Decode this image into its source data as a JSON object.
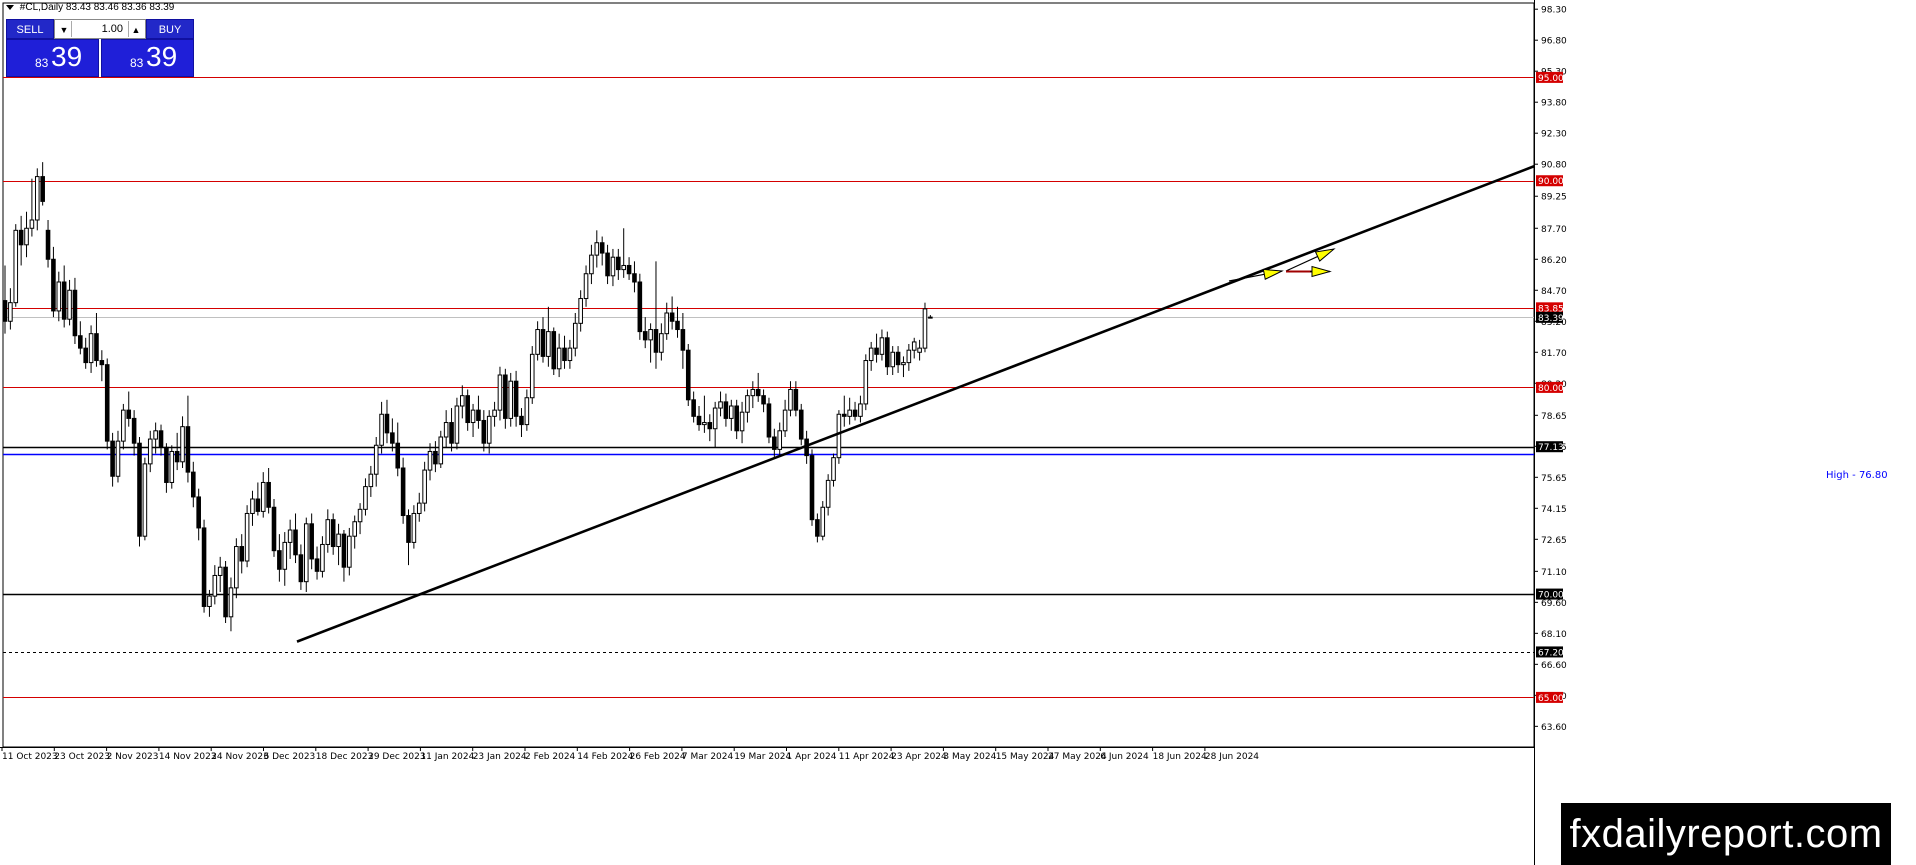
{
  "header": {
    "symbol": "#CL,Daily",
    "ohlc": "83.43 83.46 83.36 83.39"
  },
  "trade_panel": {
    "sell_label": "SELL",
    "buy_label": "BUY",
    "lot_value": "1.00",
    "sell_small": "83",
    "sell_big": "39",
    "buy_small": "83",
    "buy_big": "39"
  },
  "watermark": "fxdailyreport.com",
  "colors": {
    "support_resistance_red": "#d40000",
    "blue_line": "#0000ff",
    "trendline": "#000000",
    "arrow_yellow": "#ffff00",
    "candle_up": "#ffffff",
    "candle_down": "#000000",
    "panel_blue": "#1f1fd8"
  },
  "chart_data": {
    "type": "candlestick",
    "y_range": [
      62.6,
      98.6
    ],
    "y_ticks": [
      "98.30",
      "96.80",
      "95.30",
      "93.80",
      "92.30",
      "90.80",
      "89.25",
      "87.70",
      "86.20",
      "84.70",
      "83.20",
      "81.70",
      "80.20",
      "78.65",
      "77.15",
      "75.65",
      "74.15",
      "72.65",
      "71.10",
      "69.60",
      "68.10",
      "66.60",
      "65.10",
      "63.60"
    ],
    "x_ticks": [
      "11 Oct 2023",
      "23 Oct 2023",
      "2 Nov 2023",
      "14 Nov 2023",
      "24 Nov 2023",
      "6 Dec 2023",
      "18 Dec 2023",
      "29 Dec 2023",
      "11 Jan 2024",
      "23 Jan 2024",
      "2 Feb 2024",
      "14 Feb 2024",
      "26 Feb 2024",
      "7 Mar 2024",
      "19 Mar 2024",
      "1 Apr 2024",
      "11 Apr 2024",
      "23 Apr 2024",
      "3 May 2024",
      "15 May 2024",
      "27 May 2024",
      "6 Jun 2024",
      "18 Jun 2024",
      "28 Jun 2024"
    ],
    "horizontal_lines": [
      {
        "price": 95.0,
        "label": "95.00",
        "style": "red"
      },
      {
        "price": 90.0,
        "label": "90.00",
        "style": "red"
      },
      {
        "price": 83.85,
        "label": "83.85",
        "style": "red"
      },
      {
        "price": 80.0,
        "label": "80.00",
        "style": "red"
      },
      {
        "price": 77.13,
        "label": "77.13",
        "style": "black"
      },
      {
        "price": 76.8,
        "label": "",
        "style": "blue"
      },
      {
        "price": 70.0,
        "label": "70.00",
        "style": "black-thick"
      },
      {
        "price": 67.2,
        "label": "67.20",
        "style": "dashed"
      },
      {
        "price": 65.0,
        "label": "65.00",
        "style": "red"
      }
    ],
    "current_price": {
      "price": 83.39,
      "label": "83.39"
    },
    "high_label": "High - 76.80",
    "trendline": {
      "from": {
        "date": "18 Dec 2023",
        "price": 67.7
      },
      "to": {
        "date": "right edge",
        "price": 90.7
      }
    },
    "arrows": [
      {
        "from": [
          83.4,
          "28 Jun 2024"
        ],
        "to": [
          83.85
        ],
        "color": "yellow"
      },
      {
        "direction": "up",
        "color": "yellow"
      },
      {
        "direction": "right",
        "color": "yellow"
      }
    ],
    "candles": [
      {
        "o": 84.2,
        "h": 85.9,
        "l": 82.6,
        "c": 83.2
      },
      {
        "o": 83.2,
        "h": 84.8,
        "l": 82.8,
        "c": 84.1
      },
      {
        "o": 84.1,
        "h": 87.9,
        "l": 83.9,
        "c": 87.6
      },
      {
        "o": 87.6,
        "h": 88.3,
        "l": 85.9,
        "c": 86.9
      },
      {
        "o": 86.9,
        "h": 88.5,
        "l": 86.3,
        "c": 87.7
      },
      {
        "o": 87.7,
        "h": 90.1,
        "l": 87.3,
        "c": 88.1
      },
      {
        "o": 88.1,
        "h": 90.6,
        "l": 87.6,
        "c": 90.2
      },
      {
        "o": 90.2,
        "h": 90.9,
        "l": 88.8,
        "c": 89.0
      },
      {
        "o": 87.6,
        "h": 88.1,
        "l": 85.8,
        "c": 86.2
      },
      {
        "o": 86.2,
        "h": 86.8,
        "l": 83.4,
        "c": 83.7
      },
      {
        "o": 83.7,
        "h": 85.6,
        "l": 83.2,
        "c": 85.1
      },
      {
        "o": 85.1,
        "h": 85.9,
        "l": 82.9,
        "c": 83.3
      },
      {
        "o": 83.3,
        "h": 85.2,
        "l": 83.0,
        "c": 84.7
      },
      {
        "o": 84.7,
        "h": 85.3,
        "l": 82.1,
        "c": 82.5
      },
      {
        "o": 82.5,
        "h": 83.2,
        "l": 81.6,
        "c": 81.9
      },
      {
        "o": 81.9,
        "h": 82.4,
        "l": 80.9,
        "c": 81.2
      },
      {
        "o": 81.2,
        "h": 83.0,
        "l": 80.7,
        "c": 82.6
      },
      {
        "o": 82.6,
        "h": 83.6,
        "l": 81.0,
        "c": 81.3
      },
      {
        "o": 81.3,
        "h": 81.8,
        "l": 80.3,
        "c": 81.1
      },
      {
        "o": 81.1,
        "h": 81.4,
        "l": 77.0,
        "c": 77.4
      },
      {
        "o": 77.4,
        "h": 77.8,
        "l": 75.2,
        "c": 75.7
      },
      {
        "o": 75.7,
        "h": 77.9,
        "l": 75.4,
        "c": 77.4
      },
      {
        "o": 77.4,
        "h": 79.2,
        "l": 77.0,
        "c": 78.9
      },
      {
        "o": 78.9,
        "h": 79.8,
        "l": 78.1,
        "c": 78.5
      },
      {
        "o": 78.5,
        "h": 78.9,
        "l": 76.7,
        "c": 77.3
      },
      {
        "o": 77.3,
        "h": 77.6,
        "l": 72.3,
        "c": 72.8
      },
      {
        "o": 72.8,
        "h": 76.6,
        "l": 72.6,
        "c": 76.3
      },
      {
        "o": 76.3,
        "h": 77.9,
        "l": 75.9,
        "c": 77.5
      },
      {
        "o": 77.5,
        "h": 78.3,
        "l": 76.8,
        "c": 77.9
      },
      {
        "o": 77.9,
        "h": 78.2,
        "l": 76.7,
        "c": 77.1
      },
      {
        "o": 77.1,
        "h": 77.3,
        "l": 74.9,
        "c": 75.4
      },
      {
        "o": 75.4,
        "h": 77.2,
        "l": 75.1,
        "c": 76.9
      },
      {
        "o": 76.9,
        "h": 77.8,
        "l": 76.0,
        "c": 76.4
      },
      {
        "o": 76.4,
        "h": 78.6,
        "l": 76.1,
        "c": 78.1
      },
      {
        "o": 78.1,
        "h": 79.6,
        "l": 75.4,
        "c": 75.9
      },
      {
        "o": 75.9,
        "h": 76.4,
        "l": 74.2,
        "c": 74.7
      },
      {
        "o": 74.7,
        "h": 75.1,
        "l": 72.6,
        "c": 73.2
      },
      {
        "o": 73.2,
        "h": 73.6,
        "l": 69.1,
        "c": 69.4
      },
      {
        "o": 69.4,
        "h": 70.2,
        "l": 68.9,
        "c": 69.9
      },
      {
        "o": 69.9,
        "h": 71.4,
        "l": 69.5,
        "c": 70.9
      },
      {
        "o": 70.9,
        "h": 71.8,
        "l": 70.1,
        "c": 71.3
      },
      {
        "o": 71.3,
        "h": 71.6,
        "l": 68.6,
        "c": 68.9
      },
      {
        "o": 68.9,
        "h": 70.8,
        "l": 68.2,
        "c": 70.3
      },
      {
        "o": 70.3,
        "h": 72.7,
        "l": 69.8,
        "c": 72.3
      },
      {
        "o": 72.3,
        "h": 72.9,
        "l": 71.0,
        "c": 71.6
      },
      {
        "o": 71.6,
        "h": 74.3,
        "l": 71.3,
        "c": 73.9
      },
      {
        "o": 73.9,
        "h": 75.0,
        "l": 73.3,
        "c": 74.6
      },
      {
        "o": 74.6,
        "h": 75.4,
        "l": 73.8,
        "c": 74.0
      },
      {
        "o": 74.0,
        "h": 75.9,
        "l": 73.7,
        "c": 75.4
      },
      {
        "o": 75.4,
        "h": 76.1,
        "l": 73.9,
        "c": 74.2
      },
      {
        "o": 74.2,
        "h": 74.6,
        "l": 71.8,
        "c": 72.1
      },
      {
        "o": 72.1,
        "h": 72.9,
        "l": 70.6,
        "c": 71.2
      },
      {
        "o": 71.2,
        "h": 73.0,
        "l": 70.4,
        "c": 72.5
      },
      {
        "o": 72.5,
        "h": 73.6,
        "l": 71.7,
        "c": 73.1
      },
      {
        "o": 73.1,
        "h": 73.9,
        "l": 71.5,
        "c": 71.9
      },
      {
        "o": 71.9,
        "h": 72.4,
        "l": 70.2,
        "c": 70.6
      },
      {
        "o": 70.6,
        "h": 73.7,
        "l": 70.1,
        "c": 73.4
      },
      {
        "o": 73.4,
        "h": 73.9,
        "l": 71.2,
        "c": 71.7
      },
      {
        "o": 71.7,
        "h": 72.3,
        "l": 70.7,
        "c": 71.1
      },
      {
        "o": 71.1,
        "h": 72.8,
        "l": 70.8,
        "c": 72.4
      },
      {
        "o": 72.4,
        "h": 74.1,
        "l": 72.0,
        "c": 73.6
      },
      {
        "o": 73.6,
        "h": 73.9,
        "l": 71.9,
        "c": 72.3
      },
      {
        "o": 72.3,
        "h": 73.4,
        "l": 71.4,
        "c": 72.9
      },
      {
        "o": 72.9,
        "h": 73.1,
        "l": 70.6,
        "c": 71.3
      },
      {
        "o": 71.3,
        "h": 73.2,
        "l": 70.9,
        "c": 72.8
      },
      {
        "o": 72.8,
        "h": 73.8,
        "l": 72.2,
        "c": 73.5
      },
      {
        "o": 73.5,
        "h": 74.4,
        "l": 72.9,
        "c": 74.1
      },
      {
        "o": 74.1,
        "h": 75.6,
        "l": 73.8,
        "c": 75.2
      },
      {
        "o": 75.2,
        "h": 76.2,
        "l": 74.7,
        "c": 75.8
      },
      {
        "o": 75.8,
        "h": 77.6,
        "l": 75.2,
        "c": 77.2
      },
      {
        "o": 77.2,
        "h": 79.3,
        "l": 76.8,
        "c": 78.7
      },
      {
        "o": 78.7,
        "h": 79.4,
        "l": 77.3,
        "c": 77.8
      },
      {
        "o": 77.8,
        "h": 78.5,
        "l": 76.9,
        "c": 77.3
      },
      {
        "o": 77.3,
        "h": 78.3,
        "l": 75.7,
        "c": 76.1
      },
      {
        "o": 76.1,
        "h": 76.6,
        "l": 73.4,
        "c": 73.8
      },
      {
        "o": 73.8,
        "h": 74.1,
        "l": 71.4,
        "c": 72.5
      },
      {
        "o": 72.5,
        "h": 74.3,
        "l": 72.2,
        "c": 73.9
      },
      {
        "o": 73.9,
        "h": 74.9,
        "l": 73.5,
        "c": 74.4
      },
      {
        "o": 74.4,
        "h": 76.4,
        "l": 74.0,
        "c": 76.0
      },
      {
        "o": 76.0,
        "h": 77.3,
        "l": 75.5,
        "c": 76.9
      },
      {
        "o": 76.9,
        "h": 77.4,
        "l": 75.9,
        "c": 76.3
      },
      {
        "o": 76.3,
        "h": 77.9,
        "l": 76.1,
        "c": 77.6
      },
      {
        "o": 77.6,
        "h": 78.9,
        "l": 77.1,
        "c": 78.3
      },
      {
        "o": 78.3,
        "h": 79.0,
        "l": 76.9,
        "c": 77.3
      },
      {
        "o": 77.3,
        "h": 79.5,
        "l": 77.0,
        "c": 79.1
      },
      {
        "o": 79.1,
        "h": 80.1,
        "l": 78.5,
        "c": 79.6
      },
      {
        "o": 79.6,
        "h": 79.9,
        "l": 77.9,
        "c": 78.3
      },
      {
        "o": 78.3,
        "h": 79.2,
        "l": 77.6,
        "c": 78.9
      },
      {
        "o": 78.9,
        "h": 79.6,
        "l": 78.0,
        "c": 78.4
      },
      {
        "o": 78.4,
        "h": 78.9,
        "l": 76.9,
        "c": 77.3
      },
      {
        "o": 77.3,
        "h": 78.9,
        "l": 76.8,
        "c": 78.6
      },
      {
        "o": 78.6,
        "h": 79.3,
        "l": 78.1,
        "c": 78.9
      },
      {
        "o": 78.9,
        "h": 81.0,
        "l": 78.4,
        "c": 80.6
      },
      {
        "o": 80.6,
        "h": 80.9,
        "l": 78.0,
        "c": 78.5
      },
      {
        "o": 78.5,
        "h": 80.7,
        "l": 78.1,
        "c": 80.3
      },
      {
        "o": 80.3,
        "h": 80.8,
        "l": 78.1,
        "c": 78.6
      },
      {
        "o": 78.6,
        "h": 79.0,
        "l": 77.6,
        "c": 78.2
      },
      {
        "o": 78.2,
        "h": 79.9,
        "l": 77.9,
        "c": 79.5
      },
      {
        "o": 79.5,
        "h": 82.0,
        "l": 79.2,
        "c": 81.6
      },
      {
        "o": 81.6,
        "h": 83.2,
        "l": 81.3,
        "c": 82.8
      },
      {
        "o": 82.8,
        "h": 83.4,
        "l": 81.2,
        "c": 81.5
      },
      {
        "o": 81.5,
        "h": 83.9,
        "l": 81.0,
        "c": 82.7
      },
      {
        "o": 82.7,
        "h": 82.9,
        "l": 80.6,
        "c": 80.9
      },
      {
        "o": 80.9,
        "h": 82.6,
        "l": 80.5,
        "c": 81.9
      },
      {
        "o": 81.9,
        "h": 82.5,
        "l": 80.9,
        "c": 81.3
      },
      {
        "o": 81.3,
        "h": 82.3,
        "l": 80.9,
        "c": 81.9
      },
      {
        "o": 81.9,
        "h": 83.6,
        "l": 81.5,
        "c": 83.1
      },
      {
        "o": 83.1,
        "h": 84.7,
        "l": 82.7,
        "c": 84.3
      },
      {
        "o": 84.3,
        "h": 85.9,
        "l": 83.9,
        "c": 85.5
      },
      {
        "o": 85.5,
        "h": 86.9,
        "l": 85.0,
        "c": 86.4
      },
      {
        "o": 86.4,
        "h": 87.6,
        "l": 85.8,
        "c": 87.0
      },
      {
        "o": 87.0,
        "h": 87.3,
        "l": 85.9,
        "c": 86.5
      },
      {
        "o": 86.5,
        "h": 86.9,
        "l": 85.0,
        "c": 85.4
      },
      {
        "o": 85.4,
        "h": 86.7,
        "l": 84.9,
        "c": 86.3
      },
      {
        "o": 86.3,
        "h": 86.7,
        "l": 85.2,
        "c": 85.7
      },
      {
        "o": 85.7,
        "h": 87.7,
        "l": 85.3,
        "c": 85.9
      },
      {
        "o": 85.9,
        "h": 86.3,
        "l": 85.2,
        "c": 85.5
      },
      {
        "o": 85.5,
        "h": 86.1,
        "l": 84.6,
        "c": 85.1
      },
      {
        "o": 85.1,
        "h": 85.5,
        "l": 82.3,
        "c": 82.7
      },
      {
        "o": 82.7,
        "h": 83.4,
        "l": 81.9,
        "c": 82.3
      },
      {
        "o": 82.3,
        "h": 83.1,
        "l": 81.2,
        "c": 82.8
      },
      {
        "o": 82.8,
        "h": 86.1,
        "l": 80.9,
        "c": 81.7
      },
      {
        "o": 81.7,
        "h": 83.1,
        "l": 81.3,
        "c": 82.6
      },
      {
        "o": 82.6,
        "h": 84.1,
        "l": 82.3,
        "c": 83.6
      },
      {
        "o": 83.6,
        "h": 84.4,
        "l": 82.8,
        "c": 83.2
      },
      {
        "o": 83.2,
        "h": 83.9,
        "l": 82.4,
        "c": 82.8
      },
      {
        "o": 82.8,
        "h": 83.6,
        "l": 80.9,
        "c": 81.8
      },
      {
        "o": 81.8,
        "h": 82.1,
        "l": 79.1,
        "c": 79.4
      },
      {
        "o": 79.4,
        "h": 79.8,
        "l": 78.3,
        "c": 78.6
      },
      {
        "o": 78.6,
        "h": 79.1,
        "l": 77.9,
        "c": 78.2
      },
      {
        "o": 78.2,
        "h": 79.6,
        "l": 77.8,
        "c": 78.3
      },
      {
        "o": 78.3,
        "h": 78.7,
        "l": 77.4,
        "c": 78.0
      },
      {
        "o": 78.0,
        "h": 79.3,
        "l": 77.1,
        "c": 79.0
      },
      {
        "o": 79.0,
        "h": 79.8,
        "l": 78.6,
        "c": 79.3
      },
      {
        "o": 79.3,
        "h": 79.7,
        "l": 78.1,
        "c": 78.5
      },
      {
        "o": 78.5,
        "h": 79.4,
        "l": 77.9,
        "c": 79.1
      },
      {
        "o": 79.1,
        "h": 79.4,
        "l": 77.5,
        "c": 77.9
      },
      {
        "o": 77.9,
        "h": 79.3,
        "l": 77.3,
        "c": 78.8
      },
      {
        "o": 78.8,
        "h": 79.9,
        "l": 78.3,
        "c": 79.6
      },
      {
        "o": 79.6,
        "h": 80.3,
        "l": 79.0,
        "c": 79.9
      },
      {
        "o": 79.9,
        "h": 80.7,
        "l": 79.3,
        "c": 79.6
      },
      {
        "o": 79.6,
        "h": 79.9,
        "l": 78.8,
        "c": 79.2
      },
      {
        "o": 79.2,
        "h": 79.5,
        "l": 77.3,
        "c": 77.6
      },
      {
        "o": 77.6,
        "h": 78.0,
        "l": 76.6,
        "c": 77.0
      },
      {
        "o": 77.0,
        "h": 78.3,
        "l": 76.7,
        "c": 77.9
      },
      {
        "o": 77.9,
        "h": 79.4,
        "l": 77.6,
        "c": 78.9
      },
      {
        "o": 78.9,
        "h": 80.3,
        "l": 78.6,
        "c": 79.9
      },
      {
        "o": 79.9,
        "h": 80.3,
        "l": 78.6,
        "c": 78.9
      },
      {
        "o": 78.9,
        "h": 79.2,
        "l": 77.2,
        "c": 77.5
      },
      {
        "o": 77.5,
        "h": 77.9,
        "l": 76.3,
        "c": 76.7
      },
      {
        "o": 76.7,
        "h": 77.0,
        "l": 73.3,
        "c": 73.6
      },
      {
        "o": 73.6,
        "h": 73.9,
        "l": 72.5,
        "c": 72.8
      },
      {
        "o": 72.8,
        "h": 74.5,
        "l": 72.6,
        "c": 74.2
      },
      {
        "o": 74.2,
        "h": 75.8,
        "l": 73.8,
        "c": 75.5
      },
      {
        "o": 75.5,
        "h": 76.8,
        "l": 75.2,
        "c": 76.6
      },
      {
        "o": 76.6,
        "h": 78.9,
        "l": 76.3,
        "c": 78.7
      },
      {
        "o": 78.7,
        "h": 79.6,
        "l": 78.1,
        "c": 78.6
      },
      {
        "o": 78.6,
        "h": 79.5,
        "l": 78.2,
        "c": 78.9
      },
      {
        "o": 78.9,
        "h": 79.3,
        "l": 78.4,
        "c": 78.6
      },
      {
        "o": 78.6,
        "h": 79.6,
        "l": 78.3,
        "c": 79.2
      },
      {
        "o": 79.2,
        "h": 81.6,
        "l": 78.9,
        "c": 81.3
      },
      {
        "o": 81.3,
        "h": 82.2,
        "l": 80.8,
        "c": 81.9
      },
      {
        "o": 81.9,
        "h": 82.6,
        "l": 81.2,
        "c": 81.6
      },
      {
        "o": 81.6,
        "h": 82.8,
        "l": 81.3,
        "c": 82.4
      },
      {
        "o": 82.4,
        "h": 82.7,
        "l": 80.6,
        "c": 81.0
      },
      {
        "o": 81.0,
        "h": 82.0,
        "l": 80.6,
        "c": 81.7
      },
      {
        "o": 81.7,
        "h": 82.0,
        "l": 80.7,
        "c": 81.1
      },
      {
        "o": 81.1,
        "h": 81.5,
        "l": 80.5,
        "c": 81.2
      },
      {
        "o": 81.2,
        "h": 82.1,
        "l": 80.8,
        "c": 81.8
      },
      {
        "o": 81.8,
        "h": 82.4,
        "l": 81.4,
        "c": 82.2
      },
      {
        "o": 81.7,
        "h": 82.3,
        "l": 81.3,
        "c": 81.9
      },
      {
        "o": 81.9,
        "h": 84.1,
        "l": 81.7,
        "c": 83.8
      },
      {
        "o": 83.4,
        "h": 83.5,
        "l": 83.4,
        "c": 83.4
      }
    ]
  }
}
